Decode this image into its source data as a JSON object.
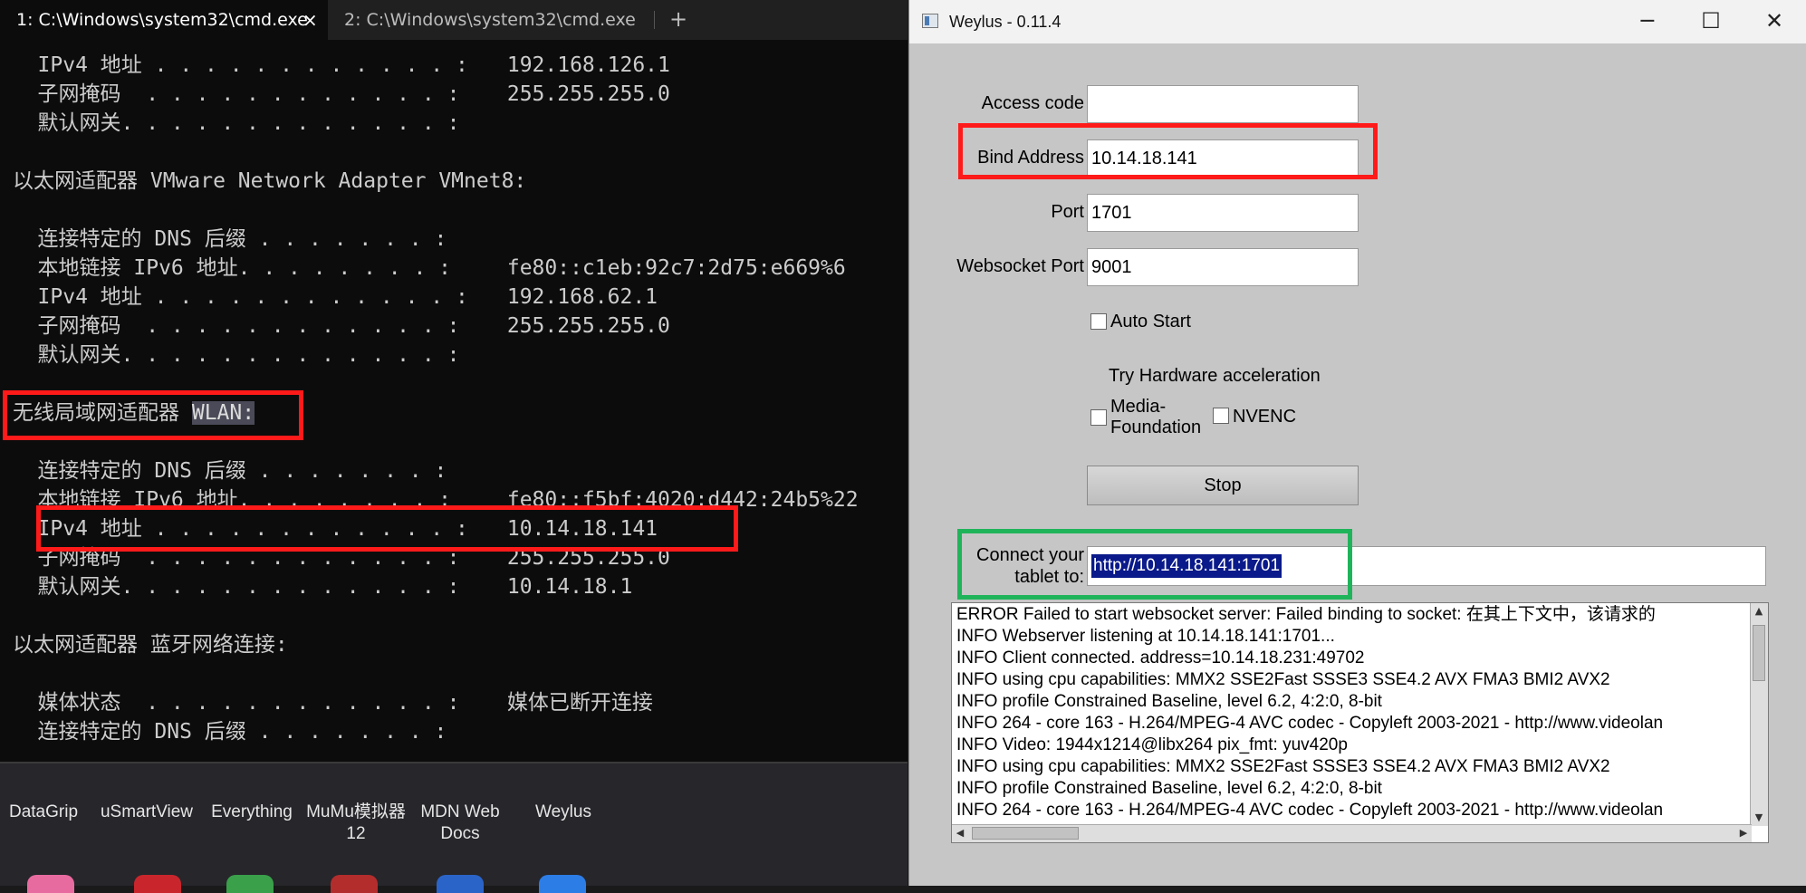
{
  "terminal": {
    "tabs": [
      {
        "label": "1: C:\\Windows\\system32\\cmd.exe",
        "close": "×"
      },
      {
        "label": "2: C:\\Windows\\system32\\cmd.exe"
      }
    ],
    "new_tab": "+",
    "lines": [
      {
        "label": "   IPv4 地址 . . . . . . . . . . . . :",
        "value": " 192.168.126.1"
      },
      {
        "label": "   子网掩码  . . . . . . . . . . . . :",
        "value": " 255.255.255.0"
      },
      {
        "label": "   默认网关. . . . . . . . . . . . . :",
        "value": ""
      },
      {
        "label": "",
        "value": ""
      },
      {
        "text": "以太网适配器 VMware Network Adapter VMnet8:"
      },
      {
        "label": "",
        "value": ""
      },
      {
        "label": "   连接特定的 DNS 后缀 . . . . . . . :",
        "value": ""
      },
      {
        "label": "   本地链接 IPv6 地址. . . . . . . . :",
        "value": " fe80::c1eb:92c7:2d75:e669%6"
      },
      {
        "label": "   IPv4 地址 . . . . . . . . . . . . :",
        "value": " 192.168.62.1"
      },
      {
        "label": "   子网掩码  . . . . . . . . . . . . :",
        "value": " 255.255.255.0"
      },
      {
        "label": "   默认网关. . . . . . . . . . . . . :",
        "value": ""
      },
      {
        "label": "",
        "value": ""
      },
      {
        "text": "无线局域网适配器 ",
        "highlight": "WLAN:"
      },
      {
        "label": "",
        "value": ""
      },
      {
        "label": "   连接特定的 DNS 后缀 . . . . . . . :",
        "value": ""
      },
      {
        "label": "   本地链接 IPv6 地址. . . . . . . . :",
        "value": " fe80::f5bf:4020:d442:24b5%22"
      },
      {
        "label": "   IPv4 地址 . . . . . . . . . . . . :",
        "value": " 10.14.18.141"
      },
      {
        "label": "   子网掩码  . . . . . . . . . . . . :",
        "value": " 255.255.255.0"
      },
      {
        "label": "   默认网关. . . . . . . . . . . . . :",
        "value": " 10.14.18.1"
      },
      {
        "label": "",
        "value": ""
      },
      {
        "text": "以太网适配器 蓝牙网络连接:"
      },
      {
        "label": "",
        "value": ""
      },
      {
        "label": "   媒体状态  . . . . . . . . . . . . :",
        "value": " 媒体已断开连接"
      },
      {
        "label": "   连接特定的 DNS 后缀 . . . . . . . :",
        "value": ""
      }
    ]
  },
  "desktop": {
    "shortcuts": [
      "DataGrip",
      "uSmartView",
      "Everything",
      "MuMu模拟器12",
      "MDN Web Docs",
      "Weylus"
    ]
  },
  "weylus": {
    "title": "Weylus - 0.11.4",
    "window_buttons": {
      "minimize": "─",
      "maximize": "☐",
      "close": "✕"
    },
    "fields": {
      "access_code": {
        "label": "Access code",
        "value": ""
      },
      "bind_address": {
        "label": "Bind Address",
        "value": "10.14.18.141"
      },
      "port": {
        "label": "Port",
        "value": "1701"
      },
      "websocket_port": {
        "label": "Websocket Port",
        "value": "9001"
      }
    },
    "auto_start": {
      "label": "Auto Start",
      "checked": false
    },
    "hw_accel": {
      "title": "Try Hardware acceleration",
      "media_foundation": {
        "label_line1": "Media-",
        "label_line2": "Foundation",
        "checked": false
      },
      "nvenc": {
        "label": "NVENC",
        "checked": false
      }
    },
    "stop_label": "Stop",
    "connect": {
      "label_line1": "Connect your",
      "label_line2": "tablet to:",
      "url": "http://10.14.18.141:1701"
    },
    "log": [
      "ERROR Failed to start websocket server: Failed binding to socket: 在其上下文中，该请求的",
      "INFO Webserver listening at 10.14.18.141:1701...",
      "INFO Client connected. address=10.14.18.231:49702",
      "INFO using cpu capabilities: MMX2 SSE2Fast SSSE3 SSE4.2 AVX FMA3 BMI2 AVX2",
      "INFO profile Constrained Baseline, level 6.2, 4:2:0, 8-bit",
      "INFO 264 - core 163 - H.264/MPEG-4 AVC codec - Copyleft 2003-2021 - http://www.videolan",
      "INFO Video: 1944x1214@libx264 pix_fmt: yuv420p",
      "INFO using cpu capabilities: MMX2 SSE2Fast SSSE3 SSE4.2 AVX FMA3 BMI2 AVX2",
      "INFO profile Constrained Baseline, level 6.2, 4:2:0, 8-bit",
      "INFO 264 - core 163 - H.264/MPEG-4 AVC codec - Copyleft 2003-2021 - http://www.videolan"
    ]
  },
  "colors": {
    "terminal_bg": "#0c0c0c",
    "annotation_red": "#ff1a1a",
    "annotation_green": "#20b45a",
    "selection_blue": "#0a1a8a"
  }
}
